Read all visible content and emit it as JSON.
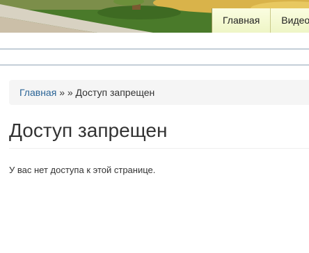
{
  "header": {
    "nav": [
      {
        "label": "Главная"
      },
      {
        "label": "Видео"
      }
    ]
  },
  "breadcrumb": {
    "home": "Главная",
    "separator": "» »",
    "current": "Доступ запрещен"
  },
  "page": {
    "title": "Доступ запрещен",
    "message": "У вас нет доступа к этой странице."
  },
  "colors": {
    "link": "#2a6496",
    "nav_bg": "#f3f8d2",
    "breadcrumb_bg": "#f5f5f5",
    "rule": "#8fa3b4"
  }
}
